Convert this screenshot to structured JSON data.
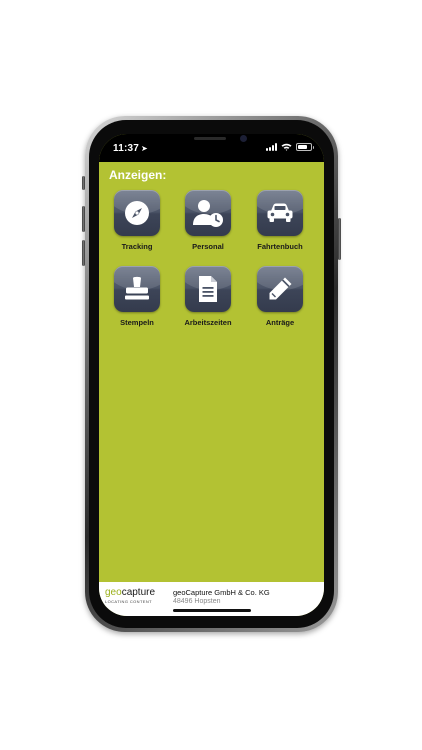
{
  "status_bar": {
    "time": "11:37",
    "location_arrow": "location-arrow-icon",
    "battery_level_percent": 75
  },
  "app": {
    "title": "Anzeigen:",
    "background_color": "#b3c233"
  },
  "tiles": [
    {
      "label": "Tracking",
      "icon": "compass-icon"
    },
    {
      "label": "Personal",
      "icon": "person-clock-icon"
    },
    {
      "label": "Fahrtenbuch",
      "icon": "car-icon"
    },
    {
      "label": "Stempeln",
      "icon": "stamp-icon"
    },
    {
      "label": "Arbeitszeiten",
      "icon": "document-icon"
    },
    {
      "label": "Anträge",
      "icon": "pencil-icon"
    }
  ],
  "footer": {
    "logo_geo": "geo",
    "logo_capture": "capture",
    "logo_tagline": "LOCATING CONTENT",
    "company": "geoCapture GmbH & Co. KG",
    "city": "48496 Hopsten"
  }
}
